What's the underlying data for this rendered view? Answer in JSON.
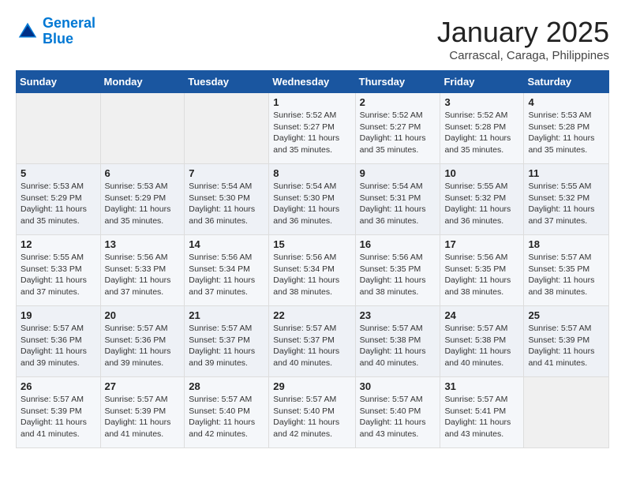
{
  "header": {
    "logo_line1": "General",
    "logo_line2": "Blue",
    "title": "January 2025",
    "location": "Carrascal, Caraga, Philippines"
  },
  "weekdays": [
    "Sunday",
    "Monday",
    "Tuesday",
    "Wednesday",
    "Thursday",
    "Friday",
    "Saturday"
  ],
  "weeks": [
    [
      {
        "day": "",
        "info": ""
      },
      {
        "day": "",
        "info": ""
      },
      {
        "day": "",
        "info": ""
      },
      {
        "day": "1",
        "info": "Sunrise: 5:52 AM\nSunset: 5:27 PM\nDaylight: 11 hours and 35 minutes."
      },
      {
        "day": "2",
        "info": "Sunrise: 5:52 AM\nSunset: 5:27 PM\nDaylight: 11 hours and 35 minutes."
      },
      {
        "day": "3",
        "info": "Sunrise: 5:52 AM\nSunset: 5:28 PM\nDaylight: 11 hours and 35 minutes."
      },
      {
        "day": "4",
        "info": "Sunrise: 5:53 AM\nSunset: 5:28 PM\nDaylight: 11 hours and 35 minutes."
      }
    ],
    [
      {
        "day": "5",
        "info": "Sunrise: 5:53 AM\nSunset: 5:29 PM\nDaylight: 11 hours and 35 minutes."
      },
      {
        "day": "6",
        "info": "Sunrise: 5:53 AM\nSunset: 5:29 PM\nDaylight: 11 hours and 35 minutes."
      },
      {
        "day": "7",
        "info": "Sunrise: 5:54 AM\nSunset: 5:30 PM\nDaylight: 11 hours and 36 minutes."
      },
      {
        "day": "8",
        "info": "Sunrise: 5:54 AM\nSunset: 5:30 PM\nDaylight: 11 hours and 36 minutes."
      },
      {
        "day": "9",
        "info": "Sunrise: 5:54 AM\nSunset: 5:31 PM\nDaylight: 11 hours and 36 minutes."
      },
      {
        "day": "10",
        "info": "Sunrise: 5:55 AM\nSunset: 5:32 PM\nDaylight: 11 hours and 36 minutes."
      },
      {
        "day": "11",
        "info": "Sunrise: 5:55 AM\nSunset: 5:32 PM\nDaylight: 11 hours and 37 minutes."
      }
    ],
    [
      {
        "day": "12",
        "info": "Sunrise: 5:55 AM\nSunset: 5:33 PM\nDaylight: 11 hours and 37 minutes."
      },
      {
        "day": "13",
        "info": "Sunrise: 5:56 AM\nSunset: 5:33 PM\nDaylight: 11 hours and 37 minutes."
      },
      {
        "day": "14",
        "info": "Sunrise: 5:56 AM\nSunset: 5:34 PM\nDaylight: 11 hours and 37 minutes."
      },
      {
        "day": "15",
        "info": "Sunrise: 5:56 AM\nSunset: 5:34 PM\nDaylight: 11 hours and 38 minutes."
      },
      {
        "day": "16",
        "info": "Sunrise: 5:56 AM\nSunset: 5:35 PM\nDaylight: 11 hours and 38 minutes."
      },
      {
        "day": "17",
        "info": "Sunrise: 5:56 AM\nSunset: 5:35 PM\nDaylight: 11 hours and 38 minutes."
      },
      {
        "day": "18",
        "info": "Sunrise: 5:57 AM\nSunset: 5:35 PM\nDaylight: 11 hours and 38 minutes."
      }
    ],
    [
      {
        "day": "19",
        "info": "Sunrise: 5:57 AM\nSunset: 5:36 PM\nDaylight: 11 hours and 39 minutes."
      },
      {
        "day": "20",
        "info": "Sunrise: 5:57 AM\nSunset: 5:36 PM\nDaylight: 11 hours and 39 minutes."
      },
      {
        "day": "21",
        "info": "Sunrise: 5:57 AM\nSunset: 5:37 PM\nDaylight: 11 hours and 39 minutes."
      },
      {
        "day": "22",
        "info": "Sunrise: 5:57 AM\nSunset: 5:37 PM\nDaylight: 11 hours and 40 minutes."
      },
      {
        "day": "23",
        "info": "Sunrise: 5:57 AM\nSunset: 5:38 PM\nDaylight: 11 hours and 40 minutes."
      },
      {
        "day": "24",
        "info": "Sunrise: 5:57 AM\nSunset: 5:38 PM\nDaylight: 11 hours and 40 minutes."
      },
      {
        "day": "25",
        "info": "Sunrise: 5:57 AM\nSunset: 5:39 PM\nDaylight: 11 hours and 41 minutes."
      }
    ],
    [
      {
        "day": "26",
        "info": "Sunrise: 5:57 AM\nSunset: 5:39 PM\nDaylight: 11 hours and 41 minutes."
      },
      {
        "day": "27",
        "info": "Sunrise: 5:57 AM\nSunset: 5:39 PM\nDaylight: 11 hours and 41 minutes."
      },
      {
        "day": "28",
        "info": "Sunrise: 5:57 AM\nSunset: 5:40 PM\nDaylight: 11 hours and 42 minutes."
      },
      {
        "day": "29",
        "info": "Sunrise: 5:57 AM\nSunset: 5:40 PM\nDaylight: 11 hours and 42 minutes."
      },
      {
        "day": "30",
        "info": "Sunrise: 5:57 AM\nSunset: 5:40 PM\nDaylight: 11 hours and 43 minutes."
      },
      {
        "day": "31",
        "info": "Sunrise: 5:57 AM\nSunset: 5:41 PM\nDaylight: 11 hours and 43 minutes."
      },
      {
        "day": "",
        "info": ""
      }
    ]
  ]
}
